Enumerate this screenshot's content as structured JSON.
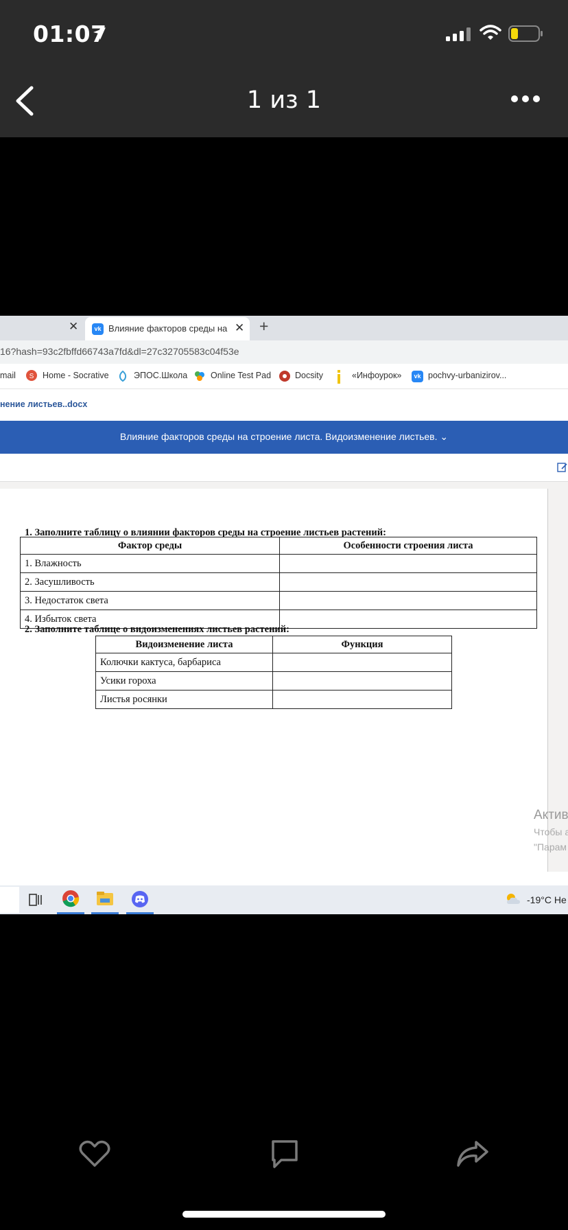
{
  "status_bar": {
    "time": "01:07"
  },
  "nav": {
    "title": "1 из 1"
  },
  "browser": {
    "active_tab_title": "Влияние факторов среды на стр",
    "url_fragment": "16?hash=93c2fbffd66743a7fd&dl=27c32705583c04f53e",
    "bookmarks": [
      {
        "label": "mail"
      },
      {
        "label": "Home - Socrative"
      },
      {
        "label": "ЭПОС.Школа"
      },
      {
        "label": "Online Test Pad"
      },
      {
        "label": "Docsity"
      },
      {
        "label": "«Инфоурок»"
      },
      {
        "label": "pochvy-urbanizirov..."
      }
    ],
    "doc_filename": "нение листьев..docx",
    "doc_header_title": "Влияние факторов среды на строение листа. Видоизменение листьев. ⌄"
  },
  "document": {
    "q1": "1. Заполните таблицу о влиянии факторов среды на строение листьев растений:",
    "table1": {
      "headers": [
        "Фактор среды",
        "Особенности строения листа"
      ],
      "rows": [
        "1. Влажность",
        "2. Засушливость",
        "3. Недостаток света",
        "4. Избыток света"
      ]
    },
    "q2": "2. Заполните таблице о видоизменениях листьев растений:",
    "table2": {
      "headers": [
        "Видоизменение листа",
        "Функция"
      ],
      "rows": [
        "Колючки кактуса, барбариса",
        "Усики гороха",
        "Листья росянки"
      ]
    },
    "watermark_line1": "Актив",
    "watermark_line2": "Чтобы а",
    "watermark_line3": "\"Парам"
  },
  "taskbar": {
    "weather": "-19°C  Не"
  },
  "colors": {
    "accent_blue": "#2b5eb4",
    "vk_blue": "#2787f5"
  }
}
